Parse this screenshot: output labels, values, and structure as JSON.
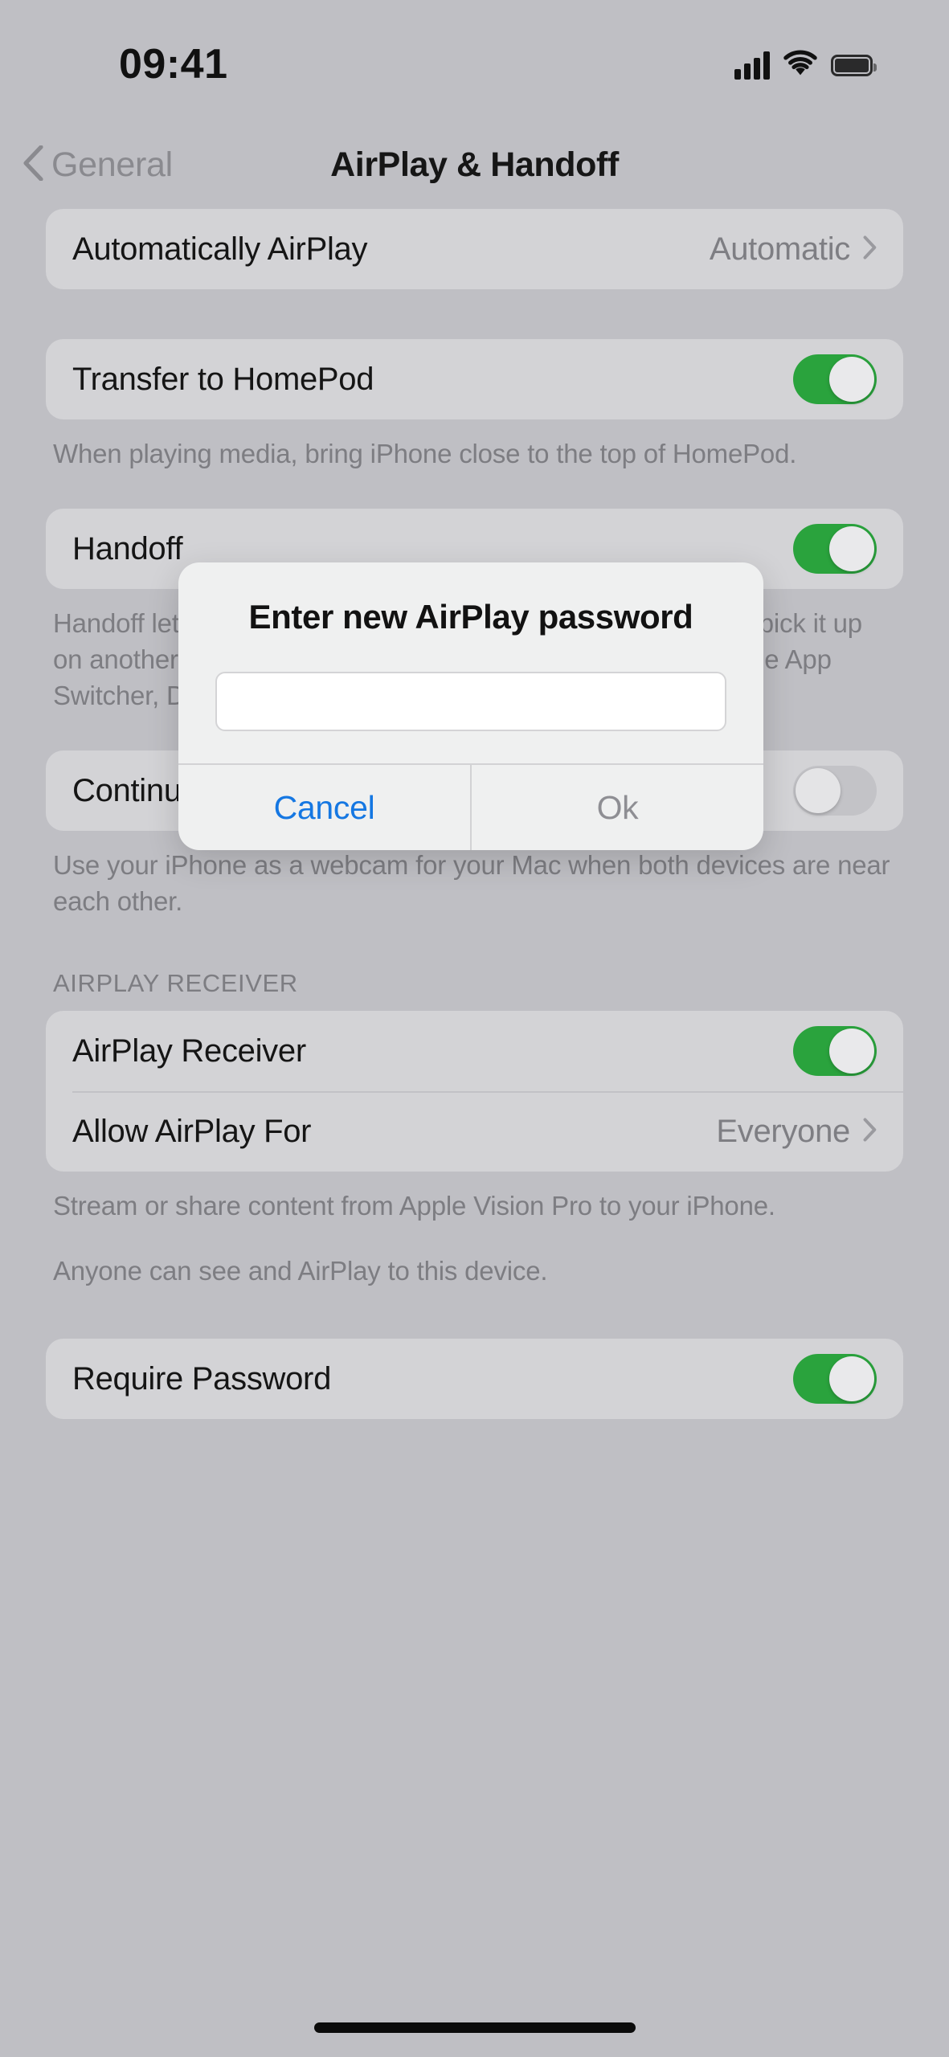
{
  "status_bar": {
    "time": "09:41",
    "signal_icon": "cellular-signal-icon",
    "wifi_icon": "wifi-icon",
    "battery_icon": "battery-icon"
  },
  "nav": {
    "back_label": "General",
    "title": "AirPlay & Handoff"
  },
  "settings": {
    "automatically_airplay": {
      "label": "Automatically AirPlay",
      "value": "Automatic"
    },
    "transfer_to_homepod": {
      "label": "Transfer to HomePod",
      "state": "on"
    },
    "transfer_to_homepod_footnote": "When playing media, bring iPhone close to the top of HomePod.",
    "handoff": {
      "label": "Handoff",
      "state": "on"
    },
    "handoff_footnote": "Handoff lets you start something on one device and instantly pick it up on another nearby device. The app you're using appears in the App Switcher, Dock, or Dock on a Mac.",
    "continuity_camera": {
      "label": "Continuity Camera",
      "state": "off"
    },
    "continuity_camera_footnote": "Use your iPhone as a webcam for your Mac when both devices are near each other.",
    "airplay_receiver_header": "AIRPLAY RECEIVER",
    "airplay_receiver": {
      "label": "AirPlay Receiver",
      "state": "on"
    },
    "allow_airplay_for": {
      "label": "Allow AirPlay For",
      "value": "Everyone"
    },
    "airplay_receiver_footnote_1": "Stream or share content from Apple Vision Pro to your iPhone.",
    "airplay_receiver_footnote_2": "Anyone can see and AirPlay to this device.",
    "require_password": {
      "label": "Require Password",
      "state": "on"
    }
  },
  "alert": {
    "title": "Enter new AirPlay password",
    "input_value": "",
    "input_placeholder": "",
    "cancel_label": "Cancel",
    "ok_label": "Ok"
  },
  "colors": {
    "toggle_on": "#2aa33d",
    "toggle_off": "#c3c3c7",
    "accent_blue": "#1577e2",
    "background": "#bfbfc4",
    "group_background": "#d3d3d6",
    "alert_background": "#eff0f0"
  }
}
